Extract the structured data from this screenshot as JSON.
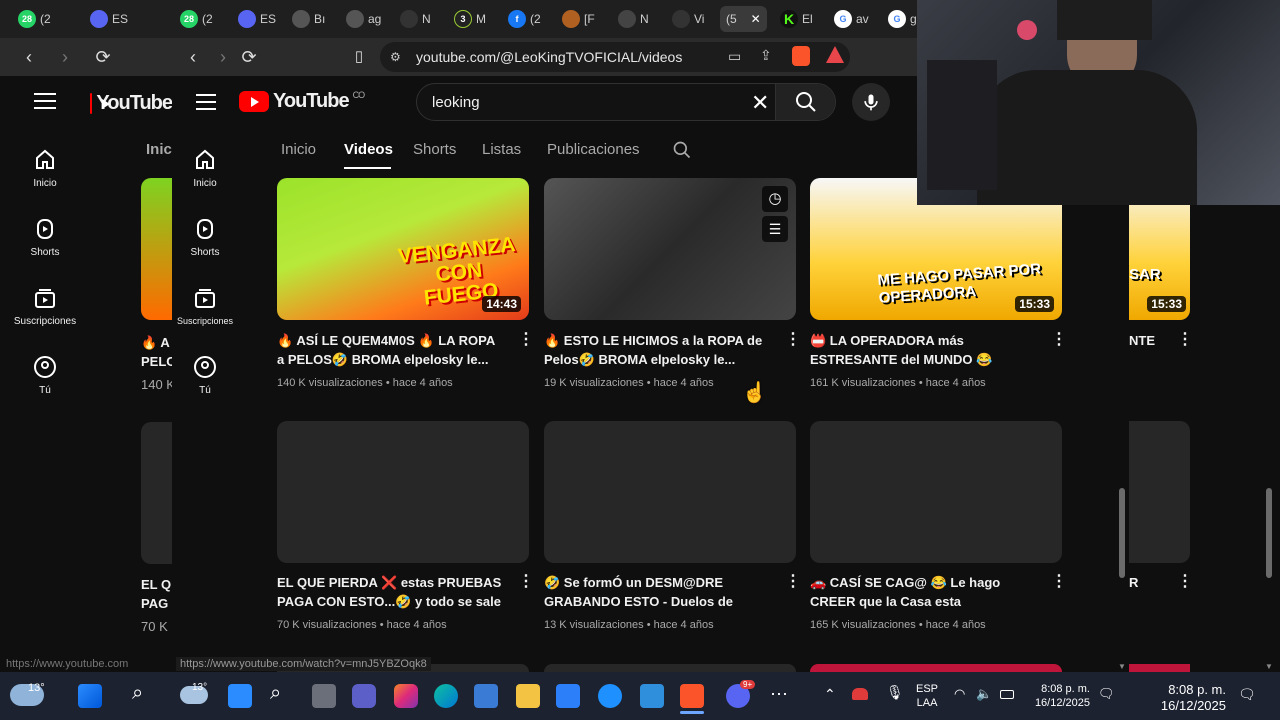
{
  "browser": {
    "tabs": [
      {
        "label": "(2",
        "badge": "28",
        "color": "#25d366"
      },
      {
        "label": "ES",
        "badge": "",
        "color": "#5865f2"
      },
      {
        "label": "(2",
        "badge": "28",
        "color": "#25d366"
      },
      {
        "label": "ES",
        "badge": "",
        "color": "#5865f2"
      },
      {
        "label": "Bı",
        "badge": "",
        "color": "#555555"
      },
      {
        "label": "ag",
        "badge": "",
        "color": "#555555"
      },
      {
        "label": "N",
        "badge": "",
        "color": "#333333"
      },
      {
        "label": "M",
        "badge": "3",
        "color": "#222222"
      },
      {
        "label": "(2",
        "badge": "f",
        "color": "#1877f2"
      },
      {
        "label": "[F",
        "badge": "",
        "color": "#b06020"
      },
      {
        "label": "N",
        "badge": "",
        "color": "#444444"
      },
      {
        "label": "Vi",
        "badge": "",
        "color": "#333333"
      },
      {
        "label": "(5",
        "badge": "",
        "color": "#3a3a3a"
      },
      {
        "label": "El",
        "badge": "K",
        "color": "#53fc18"
      },
      {
        "label": "av",
        "badge": "G",
        "color": "#4285f4"
      },
      {
        "label": "g",
        "badge": "G",
        "color": "#4285f4"
      }
    ],
    "url": "youtube.com/@LeoKingTVOFICIAL/videos",
    "status_url": "https://www.youtube.com/watch?v=mnJ5YBZOqk8",
    "status_url_back": "https://www.youtube.com"
  },
  "youtube": {
    "logo_text": "YouTube",
    "logo_country": "CO",
    "search_query": "leoking",
    "sidebar": [
      {
        "label": "Inicio",
        "icon": "home-icon"
      },
      {
        "label": "Shorts",
        "icon": "shorts-icon"
      },
      {
        "label": "Suscripciones",
        "icon": "subscriptions-icon"
      },
      {
        "label": "Tú",
        "icon": "you-icon"
      }
    ],
    "channel_tabs": [
      "Inicio",
      "Videos",
      "Shorts",
      "Listas",
      "Publicaciones"
    ],
    "selected_tab": "Videos",
    "videos": [
      {
        "title": "🔥 ASÍ LE QUEM4M0S 🔥 LA ROPA a PELOS🤣 BROMA elpelosky le...",
        "meta": "140 K visualizaciones • hace 4 años",
        "duration": "14:43",
        "thumb_text": "VENGANZA CON FUEGO"
      },
      {
        "title": "🔥 ESTO LE HICIMOS a la ROPA de Pelos🤣 BROMA elpelosky le...",
        "meta": "19 K visualizaciones • hace 4 años",
        "duration": "",
        "thumb_text": ""
      },
      {
        "title": "📛 LA OPERADORA más ESTRESANTE del MUNDO 😂 Broma telefonica...",
        "meta": "161 K visualizaciones • hace 4 años",
        "duration": "15:33",
        "thumb_text": "ME HAGO PASAR POR OPERADORA"
      },
      {
        "title": "EL QUE PIERDA ❌ estas PRUEBAS PAGA CON ESTO...🤣 y todo se sale ...",
        "meta": "70 K visualizaciones • hace 4 años",
        "duration": "",
        "thumb_text": ""
      },
      {
        "title": "🤣 Se formÓ un DESM@DRE GRABANDO ESTO - Duelos de RETOS...",
        "meta": "13 K visualizaciones • hace 4 años",
        "duration": "",
        "thumb_text": ""
      },
      {
        "title": "🚗 CASÍ SE CAG@ 😂 Le hago CREER que la Casa esta EMBRUJADA ✅...",
        "meta": "165 K visualizaciones • hace 4 años",
        "duration": "",
        "thumb_text": ""
      }
    ],
    "back_window": {
      "logo_text": "YouTube",
      "tab_label": "Inic",
      "row1_title": "🔥 A PELO",
      "row1_meta": "140 K",
      "row2_title": "EL Q PAG",
      "row2_meta": "70 K",
      "right_title": "NTE",
      "right_title2": "R",
      "right_duration": "15:33",
      "right_thumb_text": "SAR"
    }
  },
  "taskbar": {
    "weather_temp": "13°",
    "weather_temp2": "13°",
    "language": "ESP",
    "language_sub": "LAA",
    "time": "8:08 p. m.",
    "date": "16/12/2025",
    "time2": "8:08 p. m.",
    "date2": "16/12/2025",
    "discord_badge": "9+"
  }
}
